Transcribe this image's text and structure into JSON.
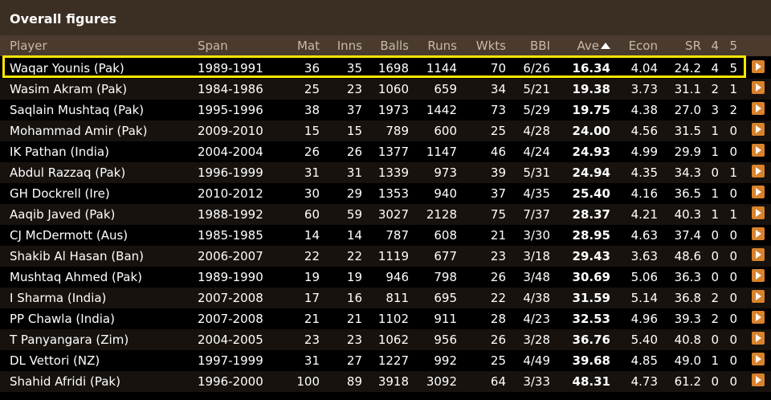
{
  "section_title": "Overall figures",
  "top_fragment": "(...)",
  "columns": {
    "player": "Player",
    "span": "Span",
    "mat": "Mat",
    "inns": "Inns",
    "balls": "Balls",
    "runs": "Runs",
    "wkts": "Wkts",
    "bbi": "BBI",
    "ave": "Ave",
    "econ": "Econ",
    "sr": "SR",
    "four": "4",
    "five": "5"
  },
  "rows": [
    [
      "Waqar Younis (Pak)",
      "1989-1991",
      "36",
      "35",
      "1698",
      "1144",
      "70",
      "6/26",
      "16.34",
      "4.04",
      "24.2",
      "4",
      "5"
    ],
    [
      "Wasim Akram (Pak)",
      "1984-1986",
      "25",
      "23",
      "1060",
      "659",
      "34",
      "5/21",
      "19.38",
      "3.73",
      "31.1",
      "2",
      "1"
    ],
    [
      "Saqlain Mushtaq (Pak)",
      "1995-1996",
      "38",
      "37",
      "1973",
      "1442",
      "73",
      "5/29",
      "19.75",
      "4.38",
      "27.0",
      "3",
      "2"
    ],
    [
      "Mohammad Amir (Pak)",
      "2009-2010",
      "15",
      "15",
      "789",
      "600",
      "25",
      "4/28",
      "24.00",
      "4.56",
      "31.5",
      "1",
      "0"
    ],
    [
      "IK Pathan (India)",
      "2004-2004",
      "26",
      "26",
      "1377",
      "1147",
      "46",
      "4/24",
      "24.93",
      "4.99",
      "29.9",
      "1",
      "0"
    ],
    [
      "Abdul Razzaq (Pak)",
      "1996-1999",
      "31",
      "31",
      "1339",
      "973",
      "39",
      "5/31",
      "24.94",
      "4.35",
      "34.3",
      "0",
      "1"
    ],
    [
      "GH Dockrell (Ire)",
      "2010-2012",
      "30",
      "29",
      "1353",
      "940",
      "37",
      "4/35",
      "25.40",
      "4.16",
      "36.5",
      "1",
      "0"
    ],
    [
      "Aaqib Javed (Pak)",
      "1988-1992",
      "60",
      "59",
      "3027",
      "2128",
      "75",
      "7/37",
      "28.37",
      "4.21",
      "40.3",
      "1",
      "1"
    ],
    [
      "CJ McDermott (Aus)",
      "1985-1985",
      "14",
      "14",
      "787",
      "608",
      "21",
      "3/30",
      "28.95",
      "4.63",
      "37.4",
      "0",
      "0"
    ],
    [
      "Shakib Al Hasan (Ban)",
      "2006-2007",
      "22",
      "22",
      "1119",
      "677",
      "23",
      "3/18",
      "29.43",
      "3.63",
      "48.6",
      "0",
      "0"
    ],
    [
      "Mushtaq Ahmed (Pak)",
      "1989-1990",
      "19",
      "19",
      "946",
      "798",
      "26",
      "3/48",
      "30.69",
      "5.06",
      "36.3",
      "0",
      "0"
    ],
    [
      "I Sharma (India)",
      "2007-2008",
      "17",
      "16",
      "811",
      "695",
      "22",
      "4/38",
      "31.59",
      "5.14",
      "36.8",
      "2",
      "0"
    ],
    [
      "PP Chawla (India)",
      "2007-2008",
      "21",
      "21",
      "1102",
      "911",
      "28",
      "4/23",
      "32.53",
      "4.96",
      "39.3",
      "2",
      "0"
    ],
    [
      "T Panyangara (Zim)",
      "2004-2005",
      "23",
      "23",
      "1062",
      "956",
      "26",
      "3/28",
      "36.76",
      "5.40",
      "40.8",
      "0",
      "0"
    ],
    [
      "DL Vettori (NZ)",
      "1997-1999",
      "31",
      "27",
      "1227",
      "992",
      "25",
      "4/49",
      "39.68",
      "4.85",
      "49.0",
      "1",
      "0"
    ],
    [
      "Shahid Afridi (Pak)",
      "1996-2000",
      "100",
      "89",
      "3918",
      "3092",
      "64",
      "3/33",
      "48.31",
      "4.73",
      "61.2",
      "0",
      "0"
    ]
  ],
  "colors": {
    "title_bg": "#3b2f24",
    "header_bg": "#4a3b2e",
    "highlight": "#ffe600",
    "button": "#d9822b"
  }
}
